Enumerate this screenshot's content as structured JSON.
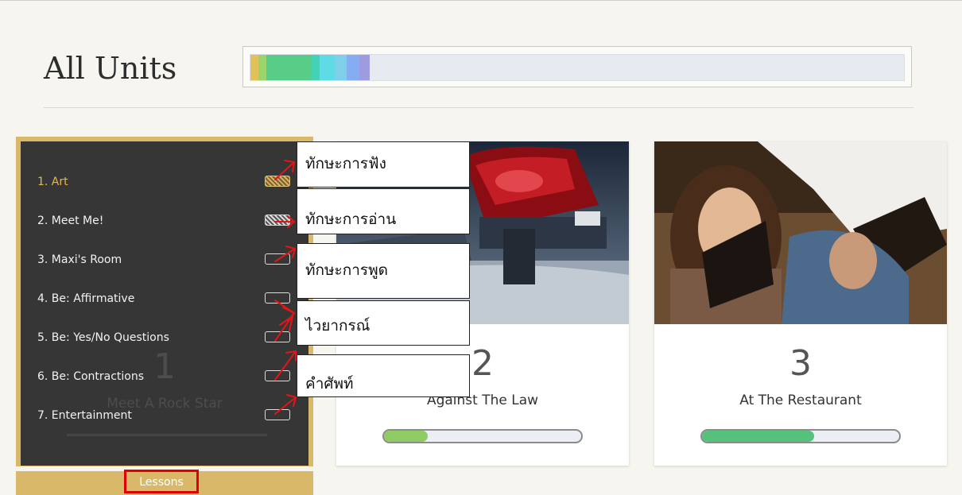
{
  "header": {
    "title": "All Units"
  },
  "overall_progress": {
    "segments": [
      {
        "color": "#e2c05a",
        "fraction": 0.012
      },
      {
        "color": "#9ad46a",
        "fraction": 0.012
      },
      {
        "color": "#58cd87",
        "fraction": 0.07
      },
      {
        "color": "#42d2b6",
        "fraction": 0.012
      },
      {
        "color": "#5fdbe5",
        "fraction": 0.023
      },
      {
        "color": "#7ecfe9",
        "fraction": 0.018
      },
      {
        "color": "#85aef2",
        "fraction": 0.02
      },
      {
        "color": "#9d9ce0",
        "fraction": 0.016
      }
    ]
  },
  "units": [
    {
      "number": "1",
      "title": "Meet A Rock Star",
      "lessons_label": "Lessons",
      "lessons": [
        {
          "label": "1. Art",
          "status": "done-gold",
          "active": true
        },
        {
          "label": "2. Meet Me!",
          "status": "done-grey",
          "active": false
        },
        {
          "label": "3. Maxi's Room",
          "status": "empty",
          "active": false
        },
        {
          "label": "4. Be: Affirmative",
          "status": "empty",
          "active": false
        },
        {
          "label": "5. Be: Yes/No Questions",
          "status": "empty",
          "active": false
        },
        {
          "label": "6. Be: Contractions",
          "status": "empty",
          "active": false
        },
        {
          "label": "7. Entertainment",
          "status": "empty",
          "active": false
        }
      ]
    },
    {
      "number": "2",
      "title": "Against The Law",
      "progress": 0.22,
      "progress_color": "#8fcc65"
    },
    {
      "number": "3",
      "title": "At The Restaurant",
      "progress": 0.57,
      "progress_color": "#55c27c"
    }
  ],
  "annotations": [
    {
      "text": "ทักษะการฟัง"
    },
    {
      "text": "ทักษะการอ่าน"
    },
    {
      "text": "ทักษะการพูด"
    },
    {
      "text": "ไวยากรณ์"
    },
    {
      "text": "คำศัพท์"
    }
  ],
  "colors": {
    "accent_gold": "#d9b86a",
    "highlight_red": "#e00000",
    "arrow_red": "#e51515"
  }
}
